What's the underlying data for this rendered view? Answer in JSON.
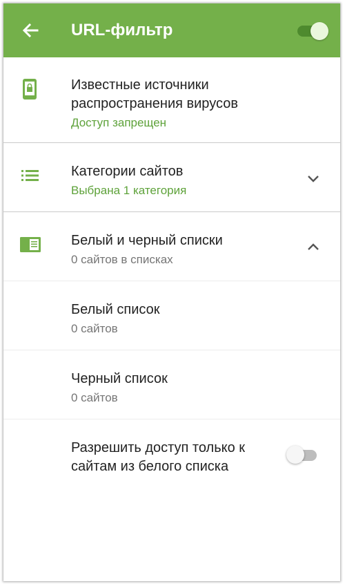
{
  "colors": {
    "accent": "#74b04a",
    "accent_text": "#5ea23a",
    "toggle_on_track": "#4e8a2e"
  },
  "header": {
    "title": "URL-фильтр",
    "back_icon": "arrow-left-icon",
    "enabled": true
  },
  "sections": {
    "virus_sources": {
      "icon": "phone-lock-icon",
      "title_line1": "Известные источники",
      "title_line2": "распространения вирусов",
      "status": "Доступ запрещен"
    },
    "categories": {
      "icon": "list-icon",
      "title": "Категории сайтов",
      "status": "Выбрана 1 категория",
      "expanded": false
    },
    "lists": {
      "icon": "list-card-icon",
      "title": "Белый и черный списки",
      "status": "0 сайтов в списках",
      "expanded": true,
      "white": {
        "title": "Белый список",
        "count": "0 сайтов"
      },
      "black": {
        "title": "Черный список",
        "count": "0 сайтов"
      },
      "whitelist_only": {
        "line1": "Разрешить доступ только к",
        "line2": "сайтам из белого списка",
        "enabled": false
      }
    }
  }
}
